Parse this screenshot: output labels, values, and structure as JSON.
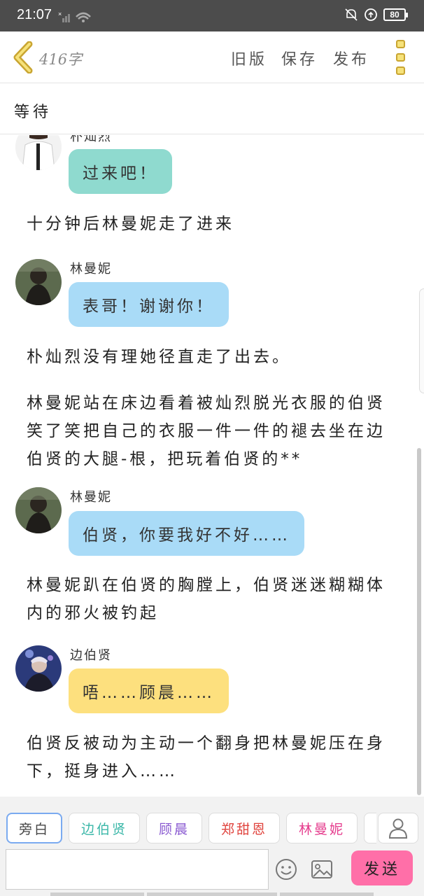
{
  "status_bar": {
    "time": "21:07",
    "battery": "80"
  },
  "toolbar": {
    "word_count": "416字",
    "old_version": "旧版",
    "save": "保存",
    "publish": "发布"
  },
  "title": "等待",
  "story": {
    "top_speaker_fragment": "朴灿烈",
    "items": [
      {
        "kind": "bubble",
        "speaker": "",
        "text": "过来吧！",
        "color": "#8fdacf"
      },
      {
        "kind": "narration",
        "text": "十分钟后林曼妮走了进来"
      },
      {
        "kind": "bubble",
        "speaker": "林曼妮",
        "text": "表哥！谢谢你！",
        "color": "#a9dbf7"
      },
      {
        "kind": "narration",
        "text": "朴灿烈没有理她径直走了出去。"
      },
      {
        "kind": "narration",
        "text": "林曼妮站在床边看着被灿烈脱光衣服的伯贤笑了笑把自己的衣服一件一件的褪去坐在边伯贤的大腿-根，把玩着伯贤的**"
      },
      {
        "kind": "bubble",
        "speaker": "林曼妮",
        "text": "伯贤，你要我好不好……",
        "color": "#a9dbf7"
      },
      {
        "kind": "narration",
        "text": "林曼妮趴在伯贤的胸膛上，伯贤迷迷糊糊体内的邪火被钓起"
      },
      {
        "kind": "bubble",
        "speaker": "边伯贤",
        "text": "唔……顾晨……",
        "color": "#fde07e"
      },
      {
        "kind": "narration",
        "text": "伯贤反被动为主动一个翻身把林曼妮压在身下，挺身进入……"
      }
    ]
  },
  "characters": [
    {
      "name": "旁白",
      "color": "#444444"
    },
    {
      "name": "边伯贤",
      "color": "#3ab7a8"
    },
    {
      "name": "顾晨",
      "color": "#8a5ad1"
    },
    {
      "name": "郑甜恩",
      "color": "#e0453f"
    },
    {
      "name": "林曼妮",
      "color": "#e53c8d"
    }
  ],
  "composer": {
    "placeholder": "",
    "send": "发送"
  }
}
